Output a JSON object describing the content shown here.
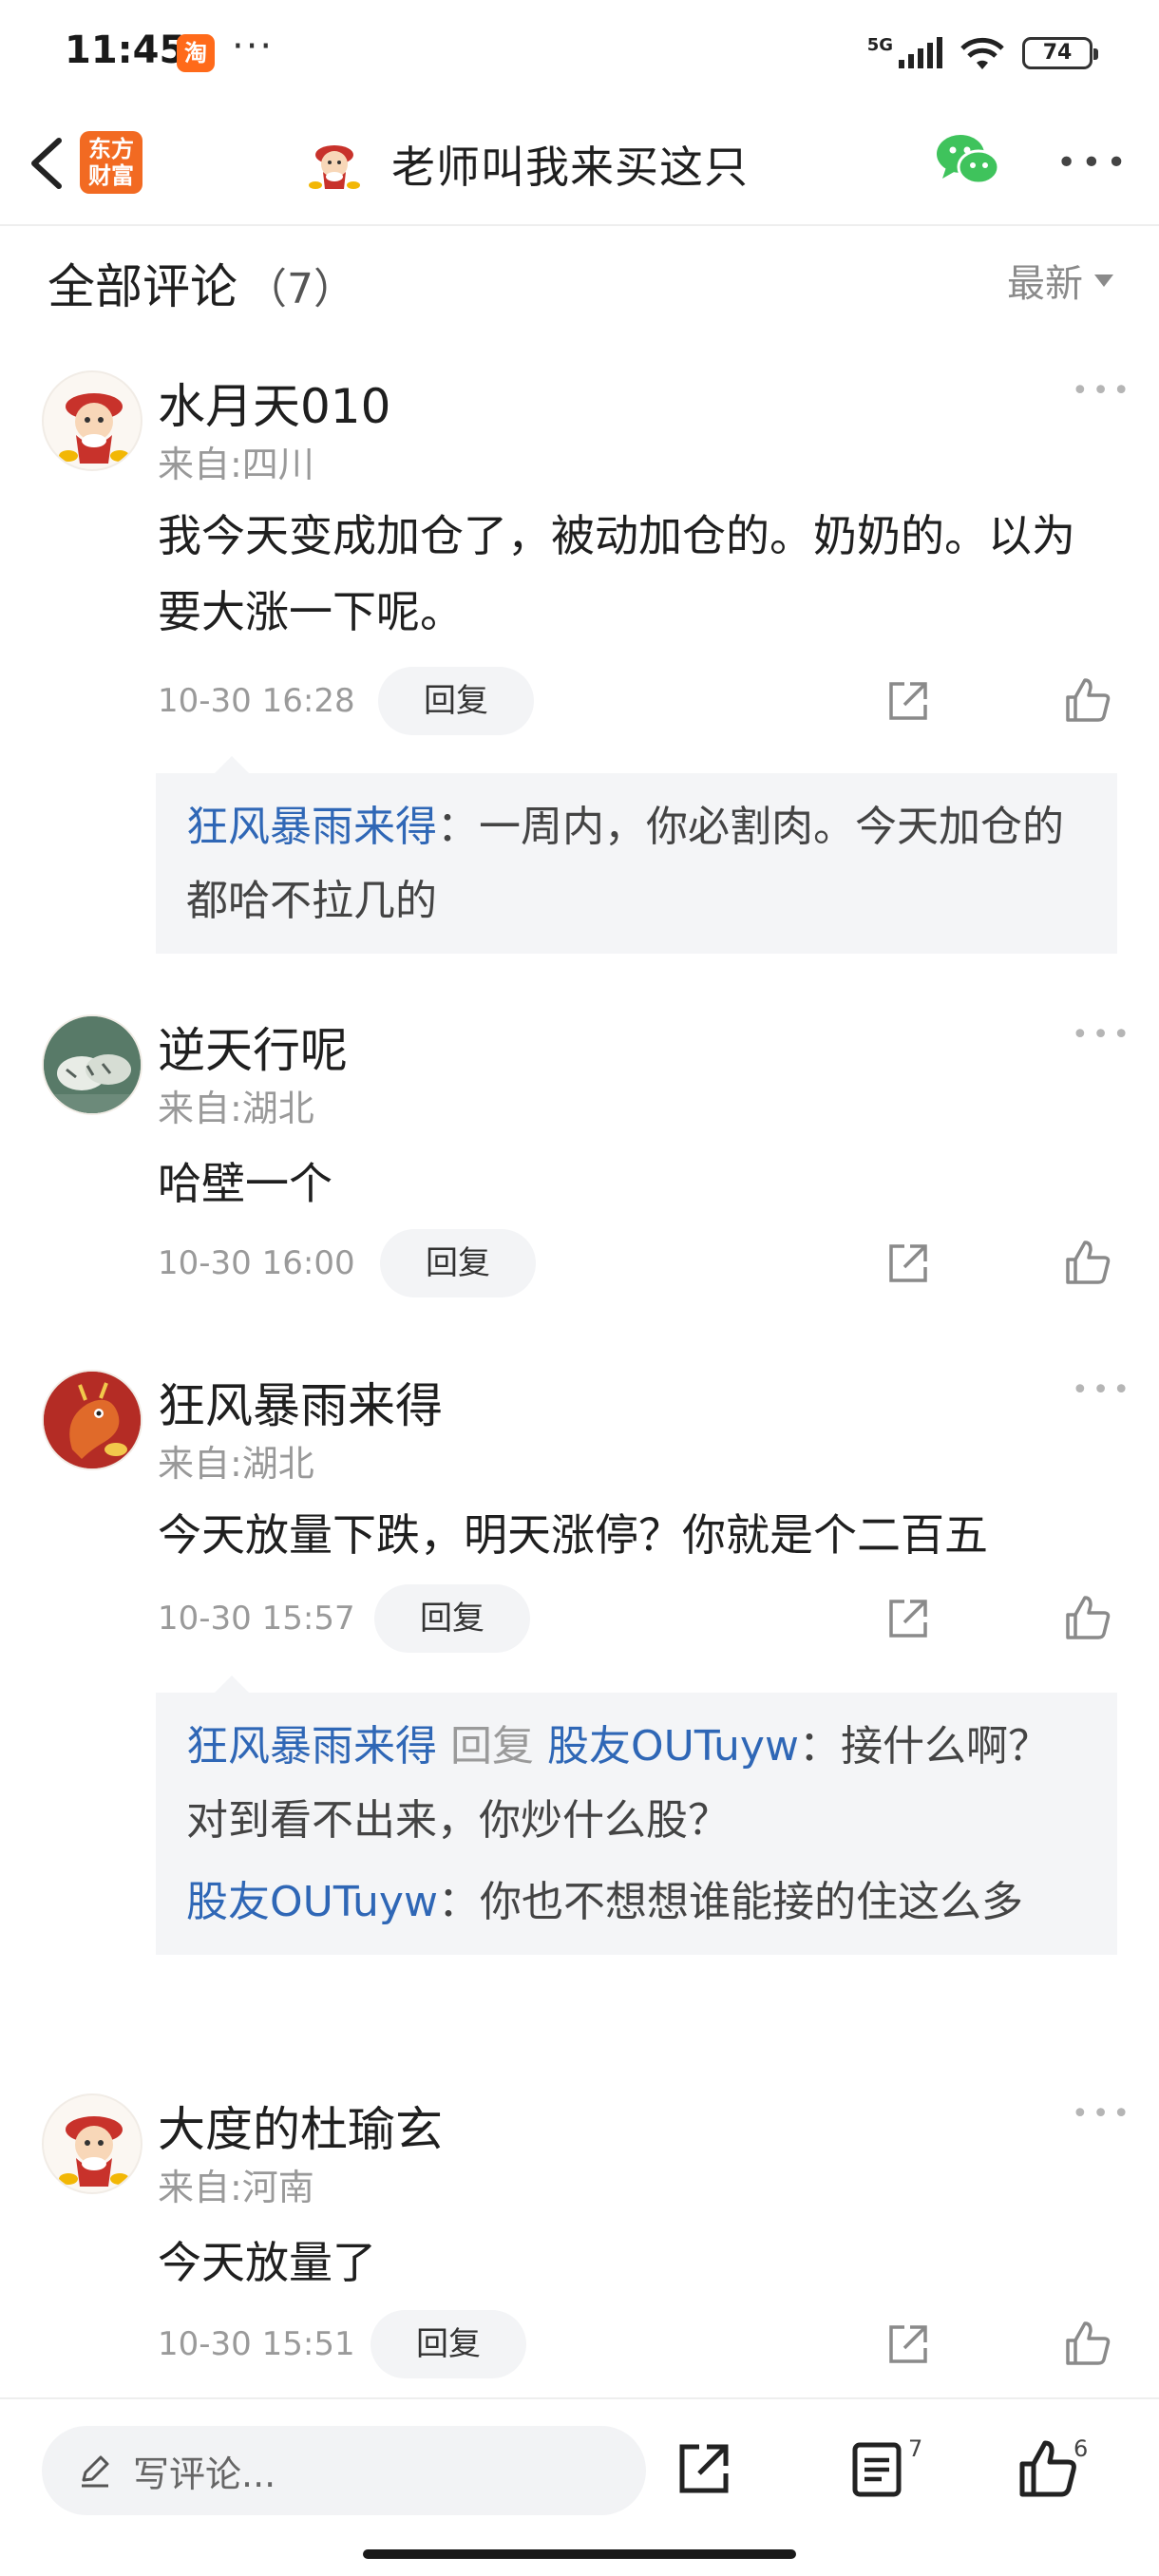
{
  "status": {
    "time": "11:45",
    "app_badge": "淘",
    "dots": "···",
    "network": "5G",
    "battery": "74"
  },
  "header": {
    "brand_line1": "东方",
    "brand_line2": "财富",
    "title": "老师叫我来买这只"
  },
  "section": {
    "title": "全部评论",
    "count": "（7）",
    "sort_label": "最新"
  },
  "comments": [
    {
      "username": "水月天010",
      "location": "来自:四川",
      "content": "我今天变成加仓了，被动加仓的。奶奶的。以为要大涨一下呢。",
      "time": "10-30 16:28",
      "reply_label": "回复",
      "replies": [
        {
          "from": "狂风暴雨来得",
          "text": "：一周内，你必割肉。今天加仓的都哈不拉几的"
        }
      ]
    },
    {
      "username": "逆天行呢",
      "location": "来自:湖北",
      "content": "哈壁一个",
      "time": "10-30 16:00",
      "reply_label": "回复"
    },
    {
      "username": "狂风暴雨来得",
      "location": "来自:湖北",
      "content": "今天放量下跌，明天涨停？你就是个二百五",
      "time": "10-30 15:57",
      "reply_label": "回复",
      "replies": [
        {
          "from": "狂风暴雨来得",
          "reply_word": "回复",
          "to": "股友OUTuyw",
          "text": "：接什么啊？对到看不出来，你炒什么股？"
        },
        {
          "from": "股友OUTuyw",
          "text": "：你也不想想谁能接的住这么多"
        }
      ]
    },
    {
      "username": "大度的杜瑜玄",
      "location": "来自:河南",
      "content": "今天放量了",
      "time": "10-30 15:51",
      "reply_label": "回复"
    }
  ],
  "bottom": {
    "input_placeholder": "写评论...",
    "comment_count": "7",
    "like_count": "6"
  },
  "colors": {
    "brand": "#f26a22",
    "link_blue": "#2f67b6",
    "wechat_green": "#3fc35c",
    "muted": "#9a9a9a"
  },
  "icons": [
    "back-arrow-icon",
    "wechat-icon",
    "more-icon",
    "share-icon",
    "thumbs-up-icon",
    "pencil-icon",
    "list-icon"
  ]
}
